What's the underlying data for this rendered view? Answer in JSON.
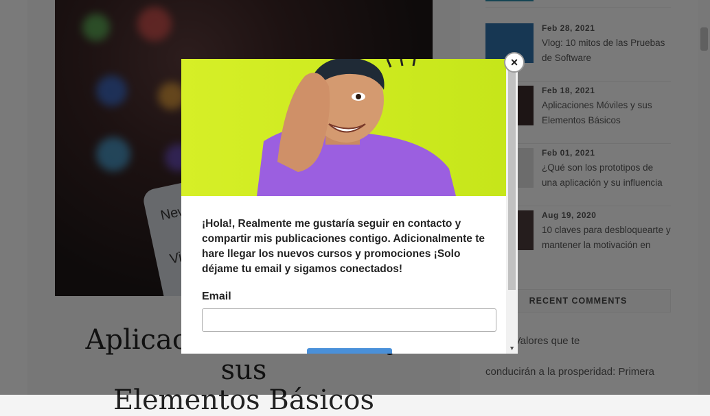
{
  "post": {
    "title_line1": "Aplicaciones Móviles y sus",
    "title_line2": "Elementos Básicos",
    "hero_menu": [
      "New Post",
      "View Activity"
    ]
  },
  "sidebar": {
    "posts": [
      {
        "date": "Feb 28, 2021",
        "title": "Vlog: 10 mitos de las Pruebas de Software"
      },
      {
        "date": "Feb 18, 2021",
        "title": "Aplicaciones Móviles y sus Elementos Básicos"
      },
      {
        "date": "Feb 01, 2021",
        "title": "¿Qué son los prototipos de una aplicación y su influencia"
      },
      {
        "date": "Aug 19, 2020",
        "title": "10 claves para desbloquearte y mantener la motivación en"
      }
    ],
    "recent_comments_heading": "RECENT COMMENTS",
    "comment_line1": "nd on Valores que te",
    "comment_line2": "conducirán a la prosperidad: Primera"
  },
  "popup": {
    "close_label": "×",
    "message": "¡Hola!, Realmente me gustaría seguir en contacto y compartir mis publicaciones contigo. Adicionalmente te hare llegar los nuevos cursos y promociones ¡Solo déjame tu email y sigamos conectados!",
    "email_label": "Email",
    "email_value": "",
    "email_placeholder": ""
  },
  "colors": {
    "overlay": "#00000080",
    "popup_image_bg": "#d6ef27",
    "shirt": "#9b5fe0",
    "submit_button": "#4a90d9"
  }
}
